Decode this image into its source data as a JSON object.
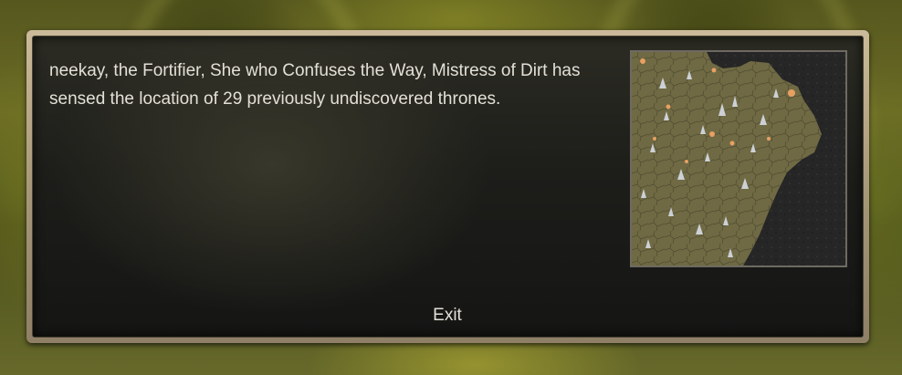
{
  "dialog": {
    "message": "neekay, the Fortifier, She who Confuses the Way, Mistress of Dirt has sensed the location of 29 previously undiscovered thrones.",
    "exit_label": "Exit"
  },
  "minimap": {
    "land_color": "#6f6a44",
    "void_color": "#2b2b2b",
    "snow_color": "#d8dde6",
    "fire_color": "#e8a062"
  },
  "background": {
    "primary_color": "#5f6222",
    "highlight_color": "#b4b04a"
  }
}
